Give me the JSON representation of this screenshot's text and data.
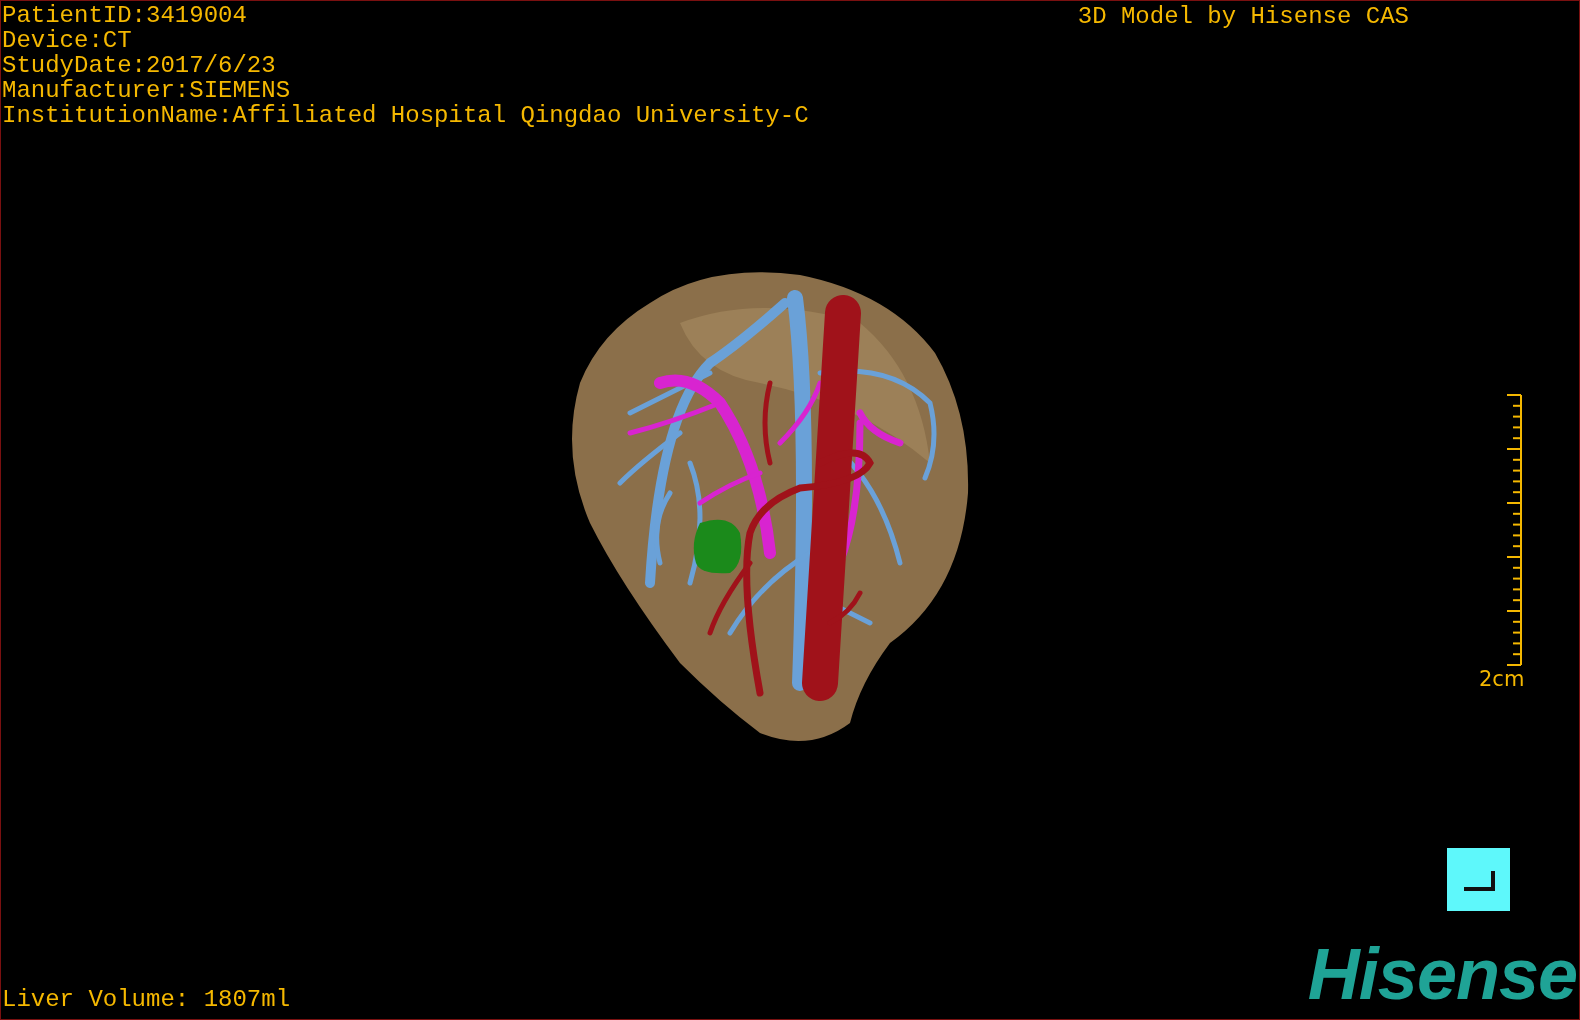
{
  "study_info": [
    "PatientID:3419004",
    "Device:CT",
    "StudyDate:2017/6/23",
    "Manufacturer:SIEMENS",
    "InstitutionName:Affiliated Hospital Qingdao University-C"
  ],
  "title": "3D Model by Hisense CAS",
  "scale": {
    "label": "2cm"
  },
  "volume": "Liver Volume: 1807ml",
  "logo": "Hisense"
}
